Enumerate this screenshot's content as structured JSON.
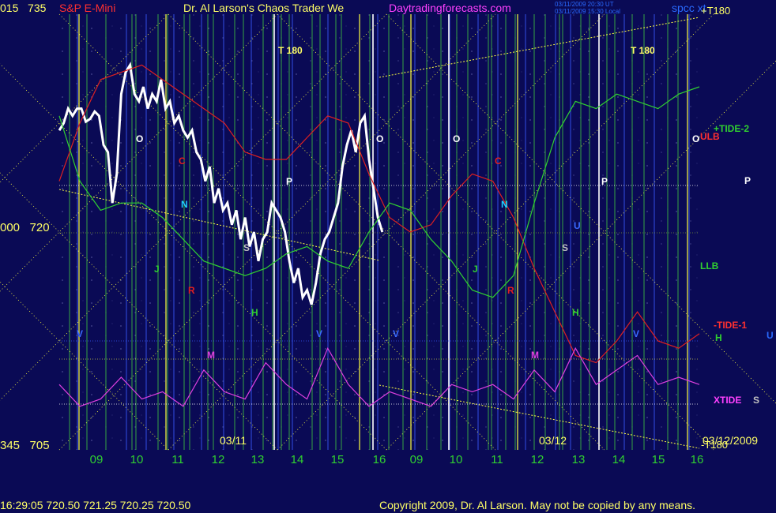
{
  "header": {
    "instrument": "S&P E-Mini",
    "title": "Dr. Al Larson's Chaos Trader We",
    "site": "Daytradingforecasts.com",
    "stamp_ut": "03/11/2009 20:30 UT",
    "stamp_local": "03/11/2009 15:30 Local",
    "space_text": "spcc  xt"
  },
  "yaxis": {
    "top_code": "015",
    "top_price": "735",
    "mid_code": "000",
    "mid_price": "720",
    "bot_code": "345",
    "bot_price": "705"
  },
  "right_labels": {
    "t180_top": "+T180",
    "t180_bottom": "-T180",
    "tide2": "+TIDE-2",
    "ulb": "ULB",
    "p": "P",
    "llb": "LLB",
    "tide1": "-TIDE-1",
    "h": "H",
    "u": "U",
    "xtide": "XTIDE",
    "s": "S"
  },
  "dates": {
    "d1": "03/11",
    "d2": "03/12",
    "d3": "03/12/2009"
  },
  "footer": {
    "quote": "16:29:05  720.50  721.25  720.25  720.50",
    "copyright": "Copyright 2009, Dr. Al Larson. May not be copied by any means."
  },
  "colors": {
    "bg": "#0a0a55",
    "price": "#ffffff",
    "red": "#e02020",
    "green": "#30d030",
    "magenta": "#e040e0",
    "yellow": "#ffff40",
    "vline_green": "#40c040",
    "vline_blue": "#3a5aff"
  },
  "chart_data": {
    "type": "line",
    "title": "S&P E-Mini",
    "ylim": [
      705,
      735
    ],
    "yticks": [
      705,
      720,
      735
    ],
    "x_ticks": [
      "09",
      "10",
      "11",
      "12",
      "13",
      "14",
      "15",
      "16",
      "09",
      "10",
      "11",
      "12",
      "13",
      "14",
      "15",
      "16"
    ],
    "last_quote": {
      "time": "16:29:05",
      "open": 720.5,
      "high": 721.25,
      "low": 720.25,
      "close": 720.5
    },
    "series": [
      {
        "name": "price",
        "color": "#ffffff",
        "values": [
          [
            0,
            727.0
          ],
          [
            2,
            727.5
          ],
          [
            4,
            728.5
          ],
          [
            6,
            728.0
          ],
          [
            8,
            728.5
          ],
          [
            10,
            728.5
          ],
          [
            12,
            727.6
          ],
          [
            14,
            727.8
          ],
          [
            16,
            728.3
          ],
          [
            18,
            728.0
          ],
          [
            20,
            726.0
          ],
          [
            22,
            725.5
          ],
          [
            24,
            722.0
          ],
          [
            26,
            724.0
          ],
          [
            28,
            729.5
          ],
          [
            30,
            731.0
          ],
          [
            32,
            731.5
          ],
          [
            34,
            729.5
          ],
          [
            36,
            729.0
          ],
          [
            38,
            730.0
          ],
          [
            40,
            728.5
          ],
          [
            42,
            729.5
          ],
          [
            44,
            729.0
          ],
          [
            46,
            730.5
          ],
          [
            48,
            728.5
          ],
          [
            50,
            729.0
          ],
          [
            52,
            727.5
          ],
          [
            54,
            728.0
          ],
          [
            56,
            727.0
          ],
          [
            58,
            726.5
          ],
          [
            60,
            727.0
          ],
          [
            62,
            725.5
          ],
          [
            64,
            725.0
          ],
          [
            66,
            723.5
          ],
          [
            68,
            724.5
          ],
          [
            70,
            722.0
          ],
          [
            72,
            723.0
          ],
          [
            74,
            721.5
          ],
          [
            76,
            722.0
          ],
          [
            78,
            720.5
          ],
          [
            80,
            721.5
          ],
          [
            82,
            719.5
          ],
          [
            84,
            721.0
          ],
          [
            86,
            719.0
          ],
          [
            88,
            720.0
          ],
          [
            90,
            718.0
          ],
          [
            92,
            719.5
          ],
          [
            94,
            720.0
          ],
          [
            96,
            722.0
          ],
          [
            98,
            721.5
          ],
          [
            100,
            721.0
          ],
          [
            102,
            720.0
          ],
          [
            104,
            718.0
          ],
          [
            106,
            716.5
          ],
          [
            108,
            717.5
          ],
          [
            110,
            715.5
          ],
          [
            112,
            716.0
          ],
          [
            114,
            715.0
          ],
          [
            116,
            716.5
          ],
          [
            118,
            718.5
          ],
          [
            120,
            719.5
          ],
          [
            122,
            720.0
          ],
          [
            124,
            721.0
          ],
          [
            126,
            722.0
          ],
          [
            128,
            724.5
          ],
          [
            130,
            726.0
          ],
          [
            132,
            727.0
          ],
          [
            134,
            725.5
          ],
          [
            136,
            727.5
          ],
          [
            138,
            728.0
          ],
          [
            140,
            725.0
          ],
          [
            142,
            723.0
          ],
          [
            144,
            721.0
          ],
          [
            146,
            720.0
          ]
        ]
      },
      {
        "name": "ULB",
        "color": "#e02020",
        "values": [
          [
            0,
            723.5
          ],
          [
            10,
            727.5
          ],
          [
            20,
            730.5
          ],
          [
            30,
            731.0
          ],
          [
            40,
            731.5
          ],
          [
            50,
            730.5
          ],
          [
            60,
            729.5
          ],
          [
            70,
            728.5
          ],
          [
            80,
            727.5
          ],
          [
            90,
            725.5
          ],
          [
            100,
            725.0
          ],
          [
            110,
            725.0
          ],
          [
            120,
            726.5
          ],
          [
            130,
            728.0
          ],
          [
            140,
            727.5
          ],
          [
            150,
            724.0
          ],
          [
            160,
            721.0
          ],
          [
            170,
            720.0
          ],
          [
            180,
            720.5
          ],
          [
            190,
            722.5
          ],
          [
            200,
            724.0
          ],
          [
            210,
            723.5
          ],
          [
            220,
            721.0
          ],
          [
            230,
            717.5
          ],
          [
            240,
            714.5
          ],
          [
            250,
            711.5
          ],
          [
            260,
            711.0
          ],
          [
            270,
            712.5
          ],
          [
            280,
            714.5
          ],
          [
            290,
            712.5
          ],
          [
            300,
            712.0
          ],
          [
            310,
            713.0
          ]
        ]
      },
      {
        "name": "LLB",
        "color": "#30d030",
        "values": [
          [
            0,
            728.0
          ],
          [
            10,
            723.5
          ],
          [
            20,
            721.5
          ],
          [
            30,
            722.0
          ],
          [
            40,
            722.0
          ],
          [
            50,
            721.0
          ],
          [
            60,
            719.5
          ],
          [
            70,
            718.0
          ],
          [
            80,
            717.5
          ],
          [
            90,
            717.0
          ],
          [
            100,
            717.5
          ],
          [
            110,
            718.5
          ],
          [
            120,
            719.0
          ],
          [
            130,
            718.0
          ],
          [
            140,
            717.5
          ],
          [
            150,
            720.0
          ],
          [
            160,
            722.0
          ],
          [
            170,
            721.5
          ],
          [
            180,
            719.5
          ],
          [
            190,
            718.0
          ],
          [
            200,
            716.0
          ],
          [
            210,
            715.5
          ],
          [
            220,
            717.0
          ],
          [
            230,
            722.0
          ],
          [
            240,
            726.5
          ],
          [
            250,
            729.0
          ],
          [
            260,
            728.5
          ],
          [
            270,
            729.5
          ],
          [
            280,
            729.0
          ],
          [
            290,
            728.5
          ],
          [
            300,
            729.5
          ],
          [
            310,
            730.0
          ]
        ]
      },
      {
        "name": "XTIDE",
        "color": "#e040e0",
        "values": [
          [
            0,
            709.5
          ],
          [
            10,
            708.0
          ],
          [
            20,
            708.5
          ],
          [
            30,
            710.0
          ],
          [
            40,
            708.5
          ],
          [
            50,
            709.0
          ],
          [
            60,
            708.0
          ],
          [
            70,
            710.5
          ],
          [
            80,
            709.0
          ],
          [
            90,
            708.5
          ],
          [
            100,
            711.0
          ],
          [
            110,
            709.5
          ],
          [
            120,
            708.5
          ],
          [
            130,
            712.0
          ],
          [
            140,
            709.5
          ],
          [
            150,
            708.0
          ],
          [
            160,
            709.0
          ],
          [
            170,
            708.5
          ],
          [
            180,
            708.0
          ],
          [
            190,
            709.5
          ],
          [
            200,
            709.0
          ],
          [
            210,
            709.5
          ],
          [
            220,
            708.5
          ],
          [
            230,
            710.5
          ],
          [
            240,
            709.0
          ],
          [
            250,
            712.0
          ],
          [
            260,
            709.5
          ],
          [
            270,
            710.5
          ],
          [
            280,
            711.5
          ],
          [
            290,
            709.5
          ],
          [
            300,
            710.0
          ],
          [
            310,
            709.5
          ]
        ]
      }
    ]
  },
  "markers": [
    {
      "t": "O",
      "c": "#ffffff"
    },
    {
      "t": "C",
      "c": "#e02020"
    },
    {
      "t": "N",
      "c": "#20d0ff"
    },
    {
      "t": "J",
      "c": "#30d030"
    },
    {
      "t": "R",
      "c": "#e02020"
    },
    {
      "t": "H",
      "c": "#30d030"
    },
    {
      "t": "M",
      "c": "#e040e0"
    },
    {
      "t": "V",
      "c": "#3a6aff"
    },
    {
      "t": "S",
      "c": "#c0c0c0"
    },
    {
      "t": "P",
      "c": "#ffffff"
    },
    {
      "t": "T 180",
      "c": "#ffff66"
    },
    {
      "t": "O",
      "c": "#ffffff"
    },
    {
      "t": "V",
      "c": "#3a6aff"
    },
    {
      "t": "O",
      "c": "#ffffff"
    },
    {
      "t": "C",
      "c": "#e02020"
    },
    {
      "t": "N",
      "c": "#20d0ff"
    },
    {
      "t": "J",
      "c": "#30d030"
    },
    {
      "t": "R",
      "c": "#e02020"
    },
    {
      "t": "M",
      "c": "#e040e0"
    },
    {
      "t": "U",
      "c": "#3a6aff"
    },
    {
      "t": "S",
      "c": "#c0c0c0"
    },
    {
      "t": "H",
      "c": "#30d030"
    },
    {
      "t": "P",
      "c": "#ffffff"
    },
    {
      "t": "V",
      "c": "#3a6aff"
    },
    {
      "t": "T 180",
      "c": "#ffff66"
    },
    {
      "t": "O",
      "c": "#ffffff"
    },
    {
      "t": "V",
      "c": "#3a6aff"
    }
  ]
}
